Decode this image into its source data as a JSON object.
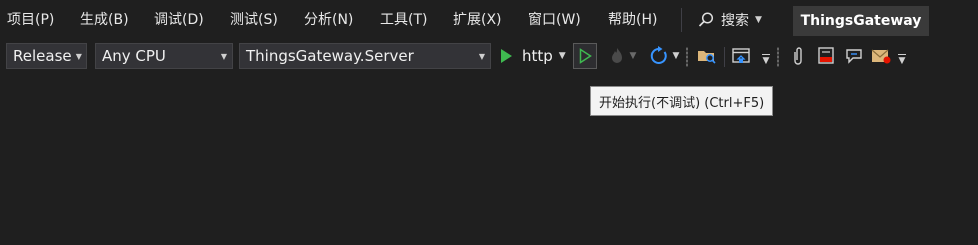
{
  "menu": {
    "items": [
      {
        "label": "项目(P)"
      },
      {
        "label": "生成(B)"
      },
      {
        "label": "调试(D)"
      },
      {
        "label": "测试(S)"
      },
      {
        "label": "分析(N)"
      },
      {
        "label": "工具(T)"
      },
      {
        "label": "扩展(X)"
      },
      {
        "label": "窗口(W)"
      },
      {
        "label": "帮助(H)"
      }
    ],
    "search_label": "搜索",
    "solution_name": "ThingsGateway"
  },
  "toolbar": {
    "configuration": "Release",
    "platform": "Any CPU",
    "startup_project": "ThingsGateway.Server",
    "run_profile": "http"
  },
  "tooltip": {
    "text": "开始执行(不调试) (Ctrl+F5)"
  },
  "colors": {
    "background": "#1f1f1f",
    "run_green": "#3fb950",
    "refresh_blue": "#3794ff",
    "folder_yellow": "#dcb67a",
    "error_red": "#e51400"
  }
}
